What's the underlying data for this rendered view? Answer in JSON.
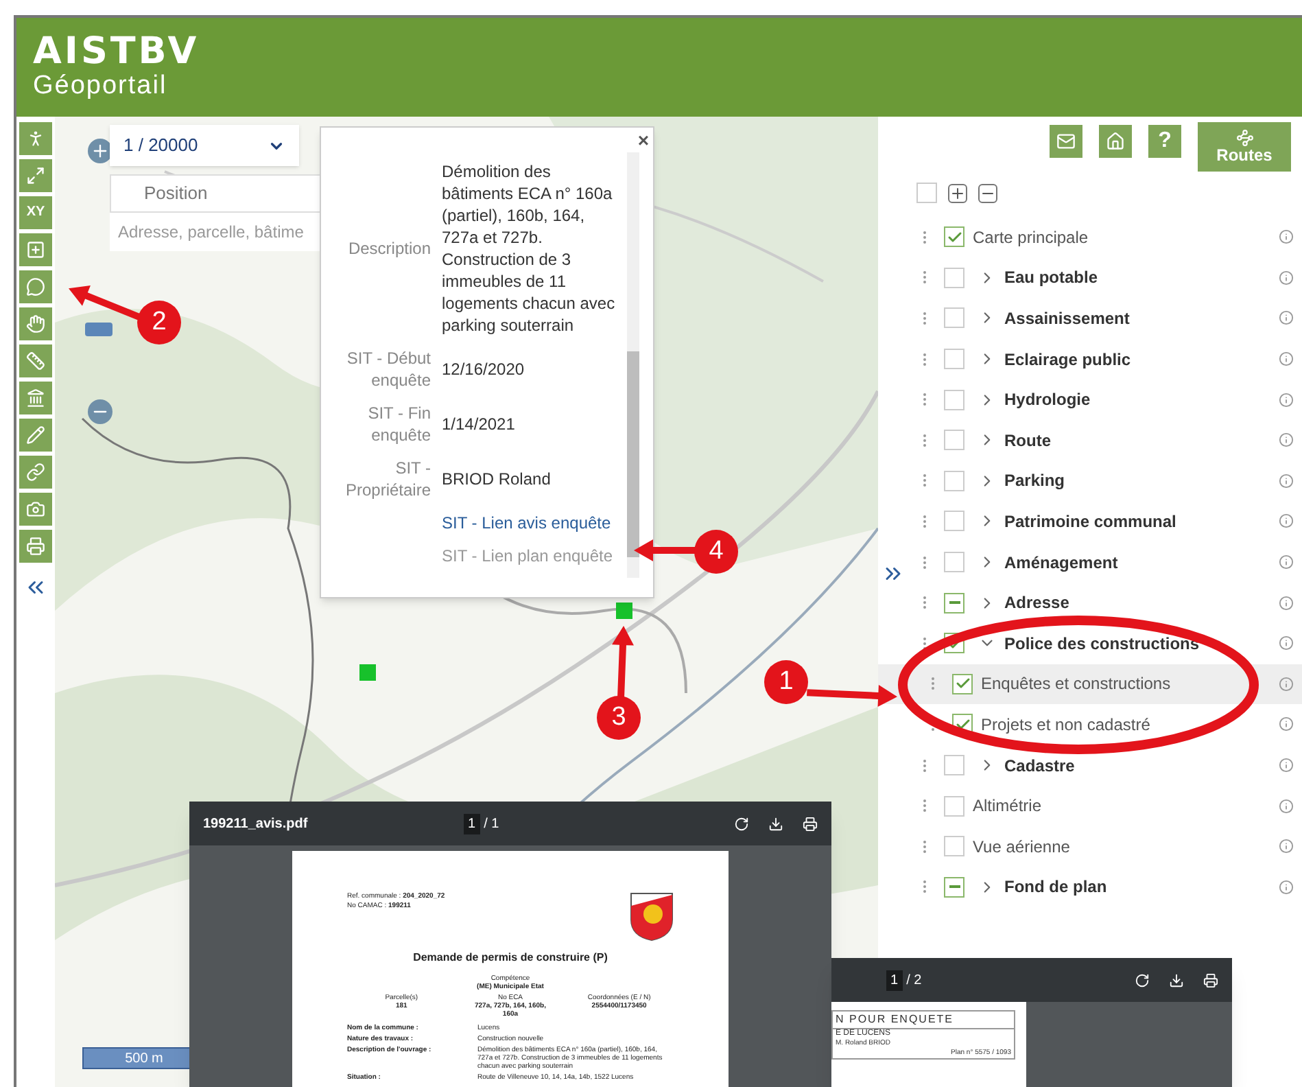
{
  "header": {
    "logo": "AISTBV",
    "subtitle": "Géoportail"
  },
  "toolbar": {
    "coordinates_button": "XY"
  },
  "map": {
    "scale": "1 / 20000",
    "position": "Position",
    "search": {
      "placeholder": "Adresse, parcelle, bâtime"
    },
    "scale_bar": "500 m"
  },
  "popup": {
    "close": "×",
    "fields": [
      {
        "label": "Description",
        "value": "Démolition des bâtiments ECA n° 160a (partiel), 160b, 164, 727a et 727b. Construction de 3 immeubles de 11 logements chacun avec parking souterrain"
      },
      {
        "label": "SIT - Début enquête",
        "value": "12/16/2020"
      },
      {
        "label": "SIT - Fin enquête",
        "value": "1/14/2021"
      },
      {
        "label": "SIT - Propriétaire",
        "value": "BRIOD Roland"
      }
    ],
    "links": [
      {
        "label": "SIT - Lien avis enquête",
        "kind": "link"
      },
      {
        "label": "SIT - Lien plan enquête",
        "kind": "muted"
      }
    ]
  },
  "panel": {
    "help": "?",
    "routes": "Routes",
    "select_all": {
      "checked": false
    },
    "layers": [
      {
        "label": "Carte principale",
        "checked": true,
        "indeterminate": false,
        "group": false,
        "selected": false
      },
      {
        "label": "Eau potable",
        "checked": false,
        "indeterminate": false,
        "group": true,
        "expanded": false,
        "selected": false
      },
      {
        "label": "Assainissement",
        "checked": false,
        "indeterminate": false,
        "group": true,
        "expanded": false,
        "selected": false
      },
      {
        "label": "Eclairage public",
        "checked": false,
        "indeterminate": false,
        "group": true,
        "expanded": false,
        "selected": false
      },
      {
        "label": "Hydrologie",
        "checked": false,
        "indeterminate": false,
        "group": true,
        "expanded": false,
        "selected": false
      },
      {
        "label": "Route",
        "checked": false,
        "indeterminate": false,
        "group": true,
        "expanded": false,
        "selected": false
      },
      {
        "label": "Parking",
        "checked": false,
        "indeterminate": false,
        "group": true,
        "expanded": false,
        "selected": false
      },
      {
        "label": "Patrimoine communal",
        "checked": false,
        "indeterminate": false,
        "group": true,
        "expanded": false,
        "selected": false
      },
      {
        "label": "Aménagement",
        "checked": false,
        "indeterminate": false,
        "group": true,
        "expanded": false,
        "selected": false
      },
      {
        "label": "Adresse",
        "checked": true,
        "indeterminate": true,
        "group": true,
        "expanded": false,
        "selected": false
      },
      {
        "label": "Police des constructions",
        "checked": true,
        "indeterminate": false,
        "group": true,
        "expanded": true,
        "selected": false,
        "children": [
          {
            "label": "Enquêtes et constructions",
            "checked": true,
            "indeterminate": false,
            "group": false,
            "selected": true
          },
          {
            "label": "Projets et non cadastré",
            "checked": true,
            "indeterminate": false,
            "group": false,
            "selected": false
          }
        ]
      },
      {
        "label": "Cadastre",
        "checked": false,
        "indeterminate": false,
        "group": true,
        "expanded": false,
        "selected": false
      },
      {
        "label": "Altimétrie",
        "checked": false,
        "indeterminate": false,
        "group": false,
        "selected": false
      },
      {
        "label": "Vue aérienne",
        "checked": false,
        "indeterminate": false,
        "group": false,
        "selected": false
      },
      {
        "label": "Fond de plan",
        "checked": true,
        "indeterminate": true,
        "group": true,
        "expanded": false,
        "selected": false
      }
    ]
  },
  "annotations": [
    {
      "number": "1"
    },
    {
      "number": "2"
    },
    {
      "number": "3"
    },
    {
      "number": "4"
    }
  ],
  "pdf_viewers": [
    {
      "kind": "notice",
      "filename": "199211_avis.pdf",
      "page": "1",
      "pages": "/ 1",
      "document": {
        "ref": "Ref. communale : **204_2020_72**",
        "camac": "No CAMAC : **199211**",
        "title": "Demande de permis de construire (P)",
        "competence_label": "Compétence",
        "competence": "(ME) Municipale Etat",
        "columns": [
          {
            "label": "Parcelle(s)",
            "value": "181"
          },
          {
            "label": "No ECA",
            "value": "727a, 727b, 164, 160b, 160a"
          },
          {
            "label": "Coordonnées (E / N)",
            "value": "2554400/1173450"
          }
        ],
        "rows": [
          {
            "label": "Nom de la commune :",
            "value": "Lucens"
          },
          {
            "label": "Nature des travaux :",
            "value": "Construction nouvelle"
          },
          {
            "label": "Description de l'ouvrage :",
            "value": "Démolition des bâtiments ECA n° 160a (partiel), 160b, 164, 727a et 727b. Construction de 3 immeubles de 11 logements chacun avec parking souterrain"
          },
          {
            "label": "Situation :",
            "value": "Route de Villeneuve 10, 14, 14a, 14b, 1522 Lucens"
          }
        ]
      }
    },
    {
      "kind": "plan",
      "page": "1",
      "pages": "/ 2",
      "document": {
        "heading": "N POUR ENQUETE",
        "lines": [
          "E DE LUCENS",
          "M. Roland BRIOD"
        ],
        "plan_number": "Plan n° 5575 / 1093"
      }
    }
  ]
}
